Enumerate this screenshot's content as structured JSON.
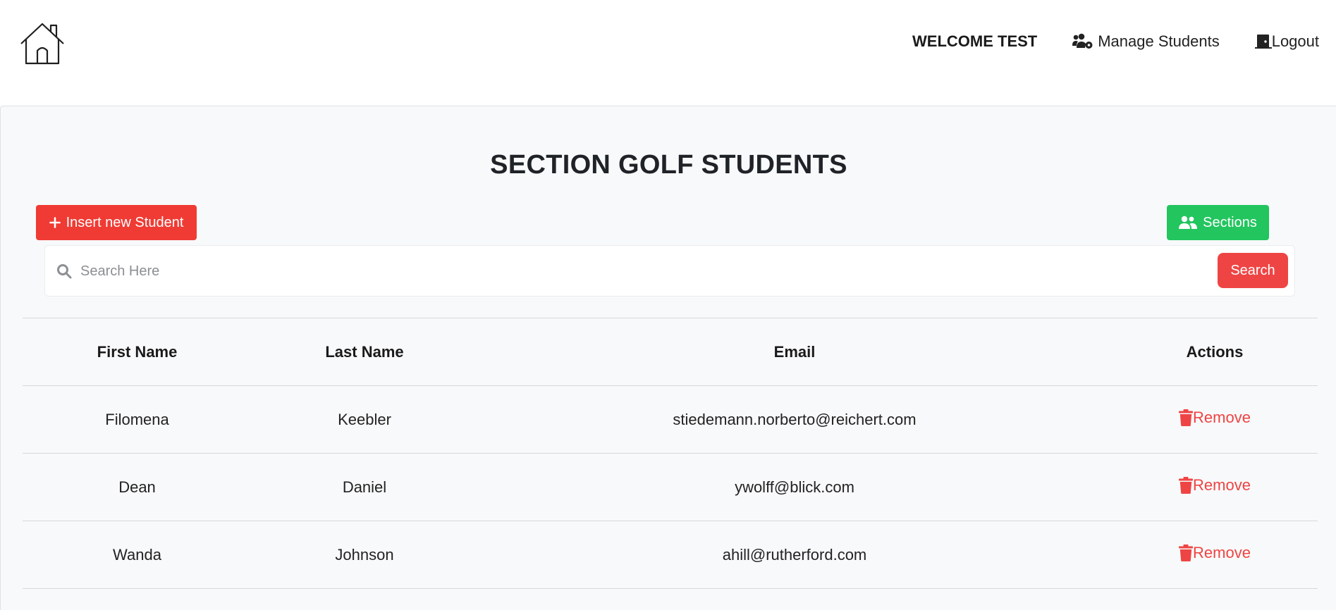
{
  "nav": {
    "welcome": "WELCOME TEST",
    "manage_students": "Manage Students",
    "logout": "Logout"
  },
  "page": {
    "title": "SECTION GOLF STUDENTS",
    "insert_label": "Insert new Student",
    "sections_label": "Sections"
  },
  "search": {
    "placeholder": "Search Here",
    "value": "",
    "button_label": "Search"
  },
  "table": {
    "headers": {
      "first_name": "First Name",
      "last_name": "Last Name",
      "email": "Email",
      "actions": "Actions"
    },
    "rows": [
      {
        "first_name": "Filomena",
        "last_name": "Keebler",
        "email": "stiedemann.norberto@reichert.com",
        "action": "Remove"
      },
      {
        "first_name": "Dean",
        "last_name": "Daniel",
        "email": "ywolff@blick.com",
        "action": "Remove"
      },
      {
        "first_name": "Wanda",
        "last_name": "Johnson",
        "email": "ahill@rutherford.com",
        "action": "Remove"
      }
    ]
  },
  "colors": {
    "insert_button": "#ef3b34",
    "sections_button": "#22c55e",
    "search_button": "#ef4444",
    "remove_link": "#ef4444"
  },
  "icons": {
    "home": "home-icon",
    "manage": "users-cog-icon",
    "logout": "door-icon",
    "insert": "plus-icon",
    "sections": "users-icon",
    "search": "search-icon",
    "remove": "trash-icon"
  }
}
